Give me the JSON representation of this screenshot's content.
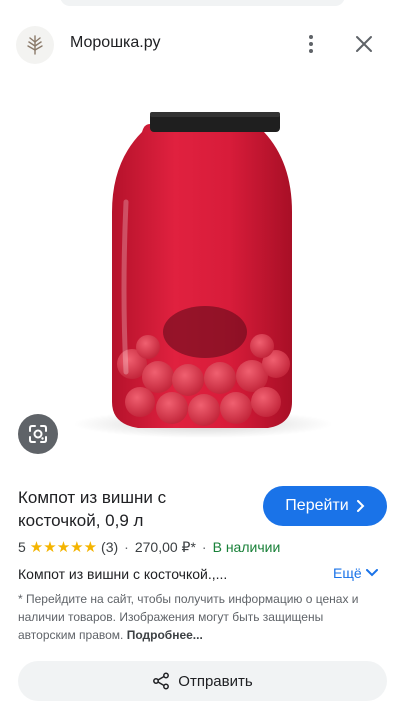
{
  "header": {
    "site_name": "Морошка.ру",
    "logo_icon": "moroshka-branch-logo",
    "menu_icon": "more-vert-icon",
    "close_icon": "close-icon"
  },
  "product": {
    "title": "Компот из вишни с косточкой, 0,9 л",
    "rating": "5",
    "stars": "★★★★★",
    "rating_value": 5,
    "reviews": "(3)",
    "price": "270,00 ₽*",
    "separator": "·",
    "availability": "В наличии",
    "description": "Компот из вишни с косточкой.,...",
    "more_label": "Ещё"
  },
  "buttons": {
    "go_label": "Перейти",
    "share_label": "Отправить"
  },
  "disclaimer": {
    "text": "* Перейдите на сайт, чтобы получить информацию о ценах и наличии товаров. Изображения могут быть защищены авторским правом.",
    "link": "Подробнее..."
  },
  "colors": {
    "accent": "#1a73e8",
    "availability": "#188038",
    "star": "#f4b400"
  }
}
